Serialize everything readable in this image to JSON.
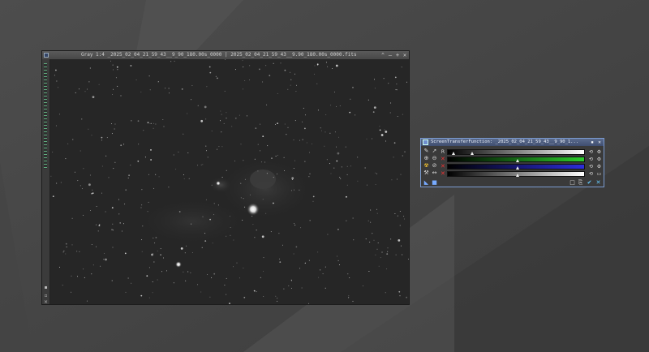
{
  "image_window": {
    "title": "Gray 1:4 _2025_02_04_21_59_43__9_90_180.00s_0000 | 2025_02_04_21_59_43__9.90_180.00s_0000.fits",
    "buttons": {
      "shade": "⌃",
      "minimize": "–",
      "maximize": "+",
      "close": "✕"
    }
  },
  "stf_window": {
    "title": "ScreenTransferFunction: _2025_02_04_21_59_43__9_90_1...",
    "buttons": {
      "pin": "▪",
      "close": "✕"
    },
    "channel_labels": [
      "R",
      "G",
      "B",
      "L"
    ],
    "channel_colors": {
      "rgb_k": "#ffffff",
      "r": "#2ccc2c",
      "g": "#2c2cdc",
      "b": "#ffffff"
    }
  },
  "icons": {
    "edit": "pen-icon",
    "select": "cursor-icon",
    "zoom_in": "zoom-in-icon",
    "zoom_out": "zoom-out-icon",
    "radiation": "radiation-icon",
    "auto_stretch": "auto-stretch-icon",
    "track": "track-icon",
    "link": "link-icon",
    "reset": "reset-icon",
    "settings": "gear-icon",
    "apply": "check-icon",
    "close": "close-icon"
  }
}
